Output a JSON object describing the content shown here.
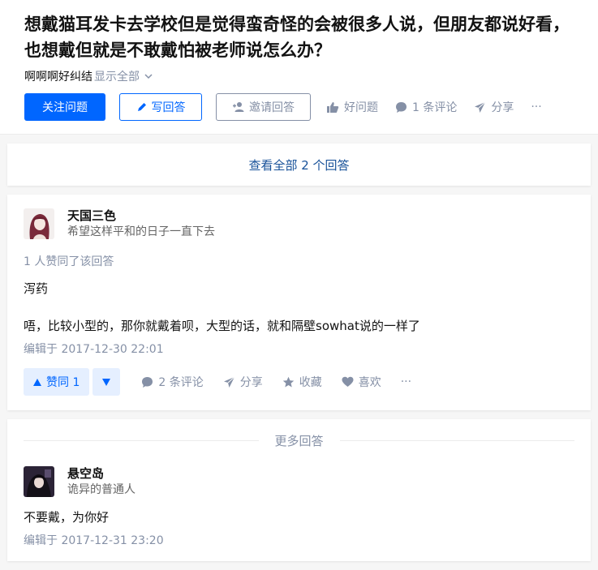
{
  "question": {
    "title": "想戴猫耳发卡去学校但是觉得蛮奇怪的会被很多人说，但朋友都说好看，也想戴但就是不敢戴怕被老师说怎么办？",
    "detail": "啊啊啊好纠结",
    "show_all": "显示全部",
    "follow_label": "关注问题",
    "write_label": "写回答",
    "invite_label": "邀请回答",
    "good_label": "好问题",
    "comments_label": "1 条评论",
    "share_label": "分享",
    "more_label": "···"
  },
  "view_all": "查看全部 2 个回答",
  "answer1": {
    "author_name": "天国三色",
    "author_bio": "希望这样平和的日子一直下去",
    "voters": "1 人赞同了该回答",
    "paragraphs": [
      "泻药",
      "唔，比较小型的，那你就戴着呗，大型的话，就和隔壁sowhat说的一样了"
    ],
    "edit_time": "编辑于 2017-12-30 22:01",
    "vote_label": "赞同 1",
    "comments_label": "2 条评论",
    "share_label": "分享",
    "collect_label": "收藏",
    "like_label": "喜欢",
    "more_label": "···"
  },
  "more_answers_label": "更多回答",
  "answer2": {
    "author_name": "悬空岛",
    "author_bio": "诡异的普通人",
    "paragraph": "不要戴，为你好",
    "edit_time": "编辑于 2017-12-31 23:20"
  },
  "colors": {
    "primary": "#0066ff",
    "muted": "#8590a6",
    "link": "#175199",
    "vote_bg": "#e5efff"
  }
}
